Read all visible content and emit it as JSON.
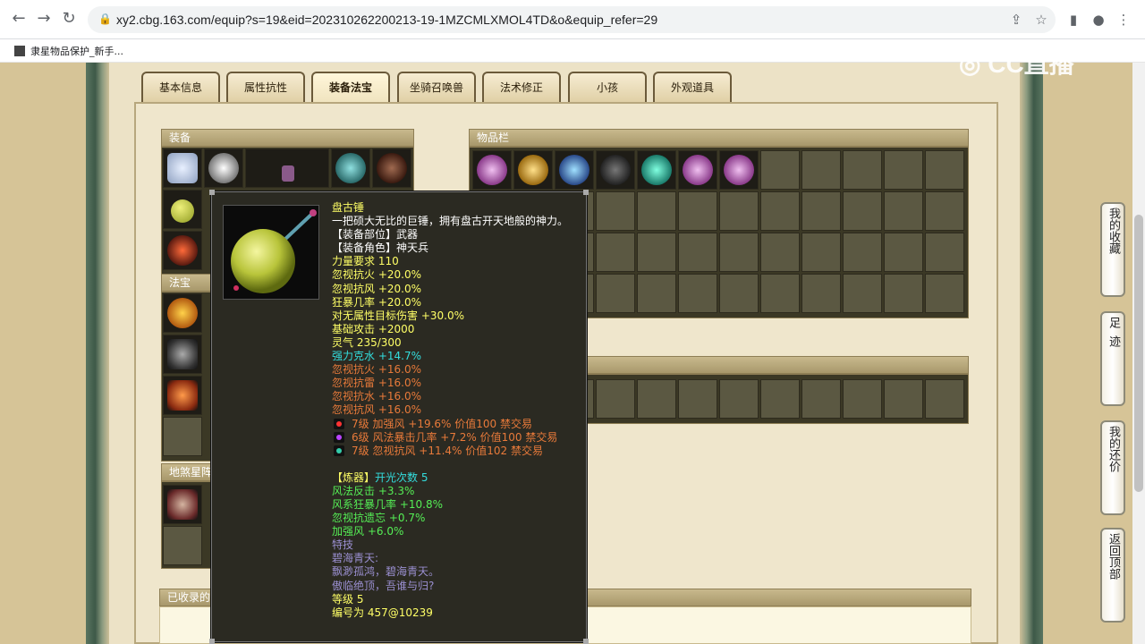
{
  "browser": {
    "url": "xy2.cbg.163.com/equip?s=19&eid=202310262200213-19-1MZCMLXMOL4TD&o&equip_refer=29",
    "bookmark": "隶星物品保护_新手..."
  },
  "watermark": "CC直播",
  "tabs": [
    "基本信息",
    "属性抗性",
    "装备法宝",
    "坐骑召唤兽",
    "法术修正",
    "小孩",
    "外观道具"
  ],
  "active_tab": 2,
  "sections": {
    "equipment": "装备",
    "inventory": "物品栏",
    "treasure": "法宝",
    "earth_star": "地煞星阵",
    "collected": "已收录的"
  },
  "side_buttons": [
    "我的收藏",
    "足迹",
    "我的还价",
    "返回顶部"
  ],
  "tooltip": {
    "name": "盘古锤",
    "desc": "一把硕大无比的巨锤，拥有盘古开天地般的神力。",
    "lines": [
      {
        "text": "【装备部位】武器",
        "color": "white"
      },
      {
        "text": "【装备角色】神天兵",
        "color": "white"
      },
      {
        "text": "力量要求 110",
        "color": "yellow"
      },
      {
        "text": "忽视抗火 +20.0%",
        "color": "yellow"
      },
      {
        "text": "忽视抗风 +20.0%",
        "color": "yellow"
      },
      {
        "text": "狂暴几率 +20.0%",
        "color": "yellow"
      },
      {
        "text": "对无属性目标伤害 +30.0%",
        "color": "yellow"
      },
      {
        "text": "基础攻击 +2000",
        "color": "yellow"
      },
      {
        "text": "灵气 235/300",
        "color": "yellow"
      },
      {
        "text": "强力克水 +14.7%",
        "color": "cyan"
      },
      {
        "text": "忽视抗火 +16.0%",
        "color": "orange"
      },
      {
        "text": "忽视抗雷 +16.0%",
        "color": "orange"
      },
      {
        "text": "忽视抗水 +16.0%",
        "color": "orange"
      },
      {
        "text": "忽视抗风 +16.0%",
        "color": "orange"
      }
    ],
    "gems": [
      {
        "text": "7级 加强风 +19.6% 价值100 禁交易",
        "gem_color": "#ff3333"
      },
      {
        "text": "6级 风法暴击几率 +7.2% 价值100 禁交易",
        "gem_color": "#bb44ff"
      },
      {
        "text": "7级 忽视抗风 +11.4% 价值102 禁交易",
        "gem_color": "#33ccaa"
      }
    ],
    "refine_label": "【炼器】",
    "refine_count": "开光次数 5",
    "refine_lines": [
      "风法反击 +3.3%",
      "风系狂暴几率 +10.8%",
      "忽视抗遗忘 +0.7%",
      "加强风 +6.0%"
    ],
    "skill_label": "特技",
    "skill_name": "碧海青天:",
    "skill_desc1": "飘渺孤鸿，碧海青天。",
    "skill_desc2": "傲临绝顶，吾谁与归?",
    "level": "等级 5",
    "serial": "编号为 457@10239"
  }
}
